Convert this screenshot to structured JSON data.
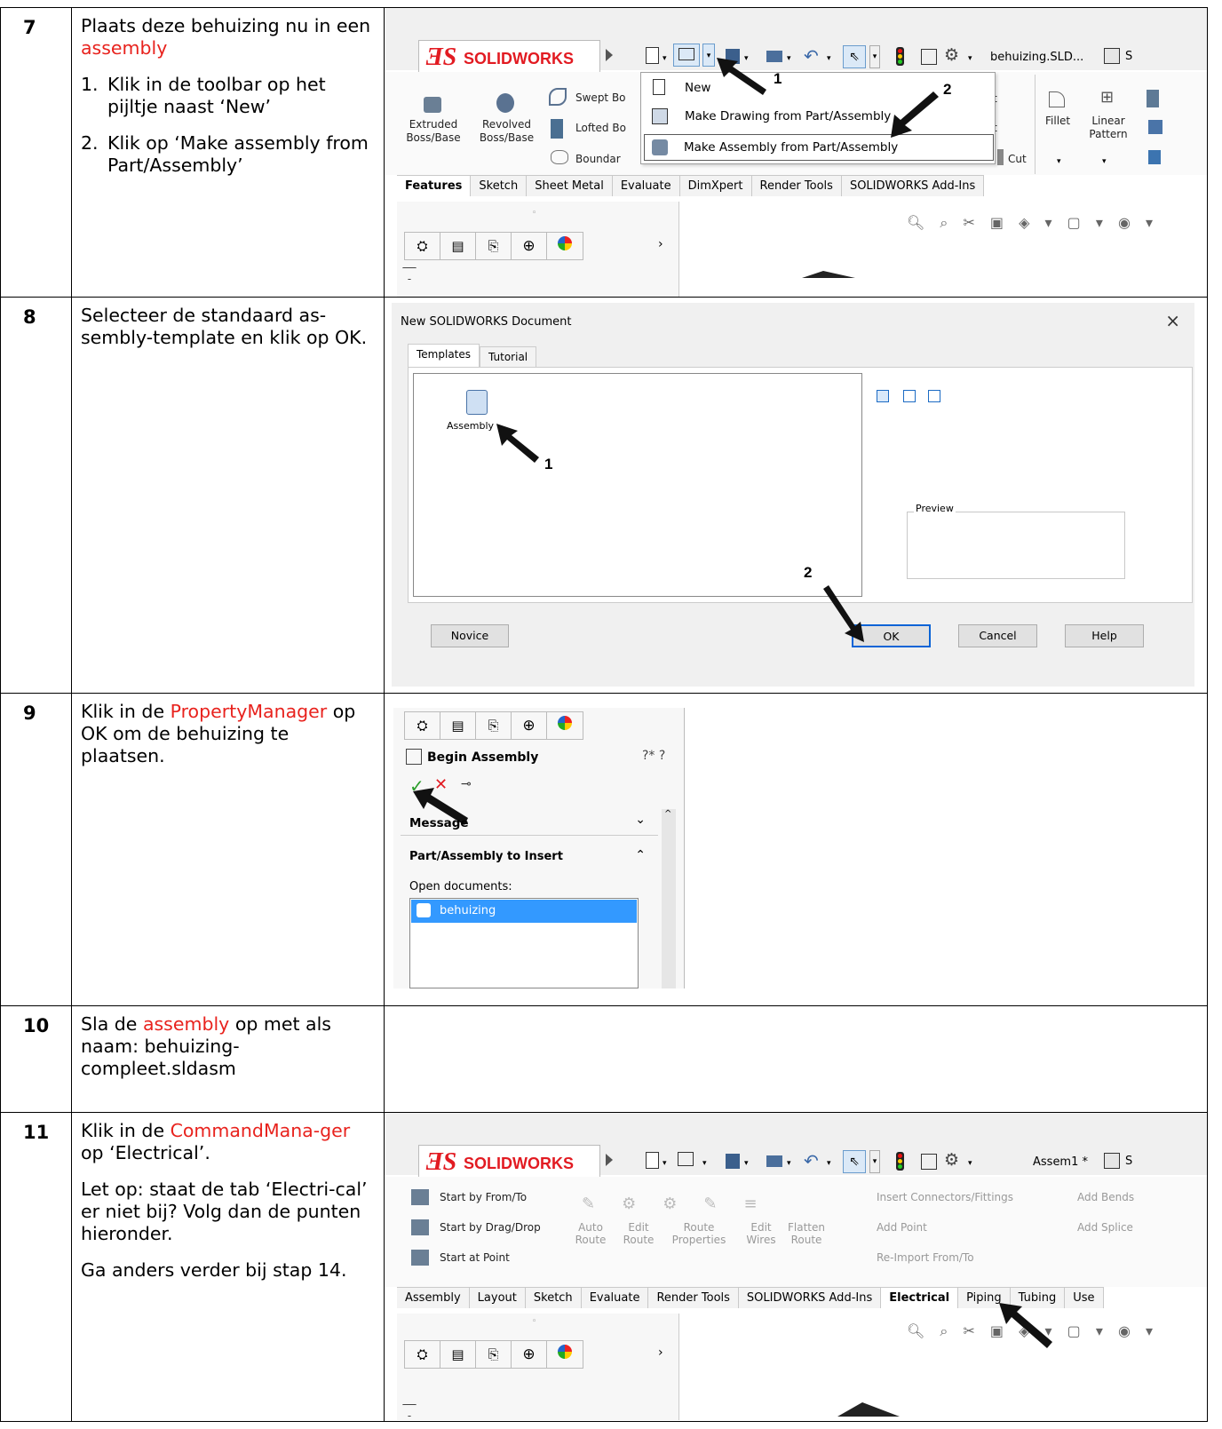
{
  "steps": [
    {
      "number": "7",
      "title_prefix": "Plaats deze behuizing nu in een ",
      "title_highlight": "assembly",
      "items": [
        {
          "n": "1.",
          "text": "Klik in de toolbar op het pijltje naast ‘New’"
        },
        {
          "n": "2.",
          "text": "Klik op ‘Make assembly from Part/Assembly’"
        }
      ]
    },
    {
      "number": "8",
      "text": "Selecteer de standaard as-sembly-template en klik op OK."
    },
    {
      "number": "9",
      "prefix": "Klik in de ",
      "highlight": "PropertyManager",
      "suffix": " op OK om de behuizing te plaatsen."
    },
    {
      "number": "10",
      "prefix": "Sla de ",
      "highlight": "assembly",
      "suffix": " op met als naam: behuizing-compleet.sldasm"
    },
    {
      "number": "11",
      "prefix": "Klik in de ",
      "highlight": "CommandMana-ger",
      "suffix": " op ‘Electrical’.",
      "note": "Let op: staat de tab ‘Electri-cal’ er niet bij? Volg dan de punten hieronder.",
      "note2": "Ga anders verder bij stap 14."
    }
  ],
  "shot7": {
    "brand": "SOLIDWORKS",
    "filename": "behuizing.SLD...",
    "btn_extruded": "Extruded Boss/Base",
    "btn_revolved": "Revolved Boss/Base",
    "btn_swept": "Swept Bo",
    "btn_lofted": "Lofted Bo",
    "btn_boundary": "Boundar",
    "btn_cut": "Cut",
    "btn_fillet": "Fillet",
    "btn_linear": "Linear Pattern",
    "menu": [
      "New",
      "Make Drawing from Part/Assembly",
      "Make Assembly from Part/Assembly"
    ],
    "tabs": [
      "Features",
      "Sketch",
      "Sheet Metal",
      "Evaluate",
      "DimXpert",
      "Render Tools",
      "SOLIDWORKS Add-Ins"
    ],
    "callout1": "1",
    "callout2": "2"
  },
  "shot8": {
    "title": "New SOLIDWORKS Document",
    "tabs": [
      "Templates",
      "Tutorial"
    ],
    "template": "Assembly",
    "preview": "Preview",
    "buttons": {
      "novice": "Novice",
      "ok": "OK",
      "cancel": "Cancel",
      "help": "Help"
    },
    "callout1": "1",
    "callout2": "2"
  },
  "shot9": {
    "title": "Begin Assembly",
    "section_message": "Message",
    "section_part": "Part/Assembly to Insert",
    "open_docs": "Open documents:",
    "doc": "behuizing"
  },
  "shot11": {
    "brand": "SOLIDWORKS",
    "filename": "Assem1 *",
    "start_from_to": "Start by From/To",
    "start_drag": "Start by Drag/Drop",
    "start_point": "Start at Point",
    "auto_route": "Auto Route",
    "edit_route": "Edit Route",
    "route_props": "Route Properties",
    "edit_wires": "Edit Wires",
    "flatten_route": "Flatten Route",
    "insert_conn": "Insert Connectors/Fittings",
    "add_point": "Add Point",
    "reimport": "Re-Import From/To",
    "add_bends": "Add Bends",
    "add_splice": "Add Splice",
    "tabs": [
      "Assembly",
      "Layout",
      "Sketch",
      "Evaluate",
      "Render Tools",
      "SOLIDWORKS Add-Ins",
      "Electrical",
      "Piping",
      "Tubing",
      "Use"
    ]
  }
}
